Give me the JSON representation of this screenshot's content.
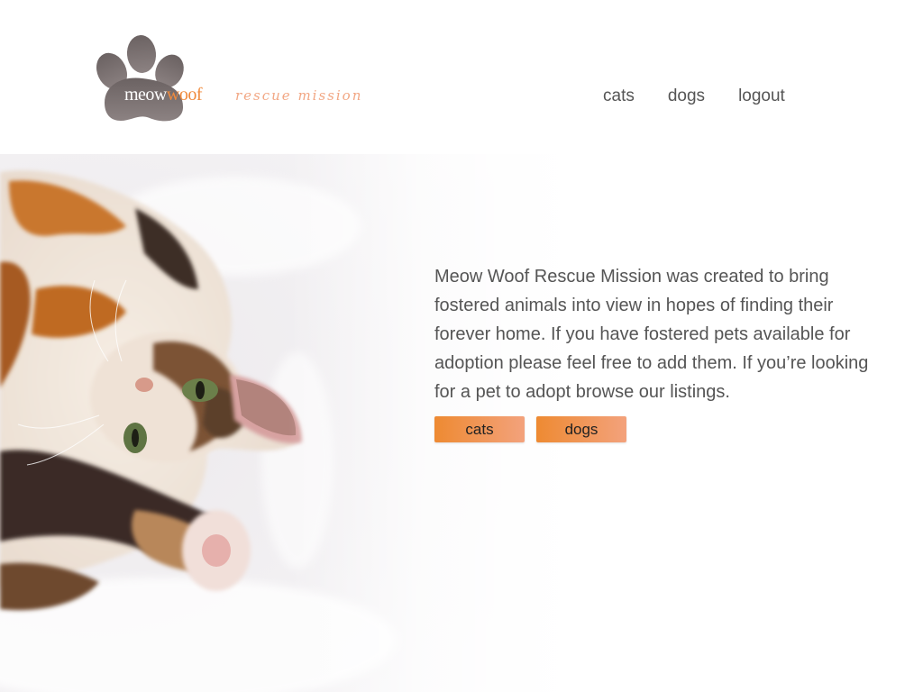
{
  "brand": {
    "name_part1": "meow",
    "name_part2": "woof",
    "tagline": "rescue mission",
    "logo_icon": "paw-print-icon",
    "accent_color": "#f08a3c",
    "paw_color": "#7a6f6f"
  },
  "nav": {
    "items": [
      {
        "label": "cats"
      },
      {
        "label": "dogs"
      },
      {
        "label": "logout"
      }
    ]
  },
  "hero": {
    "image": "calico-cat-lying-on-white-blanket",
    "intro": "Meow Woof Rescue Mission was created to bring fostered animals into view in hopes of finding their forever home. If you have fostered pets available for adoption please feel free to add them. If you’re looking for a pet to adopt browse our listings.",
    "buttons": [
      {
        "label": "cats"
      },
      {
        "label": "dogs"
      }
    ]
  }
}
